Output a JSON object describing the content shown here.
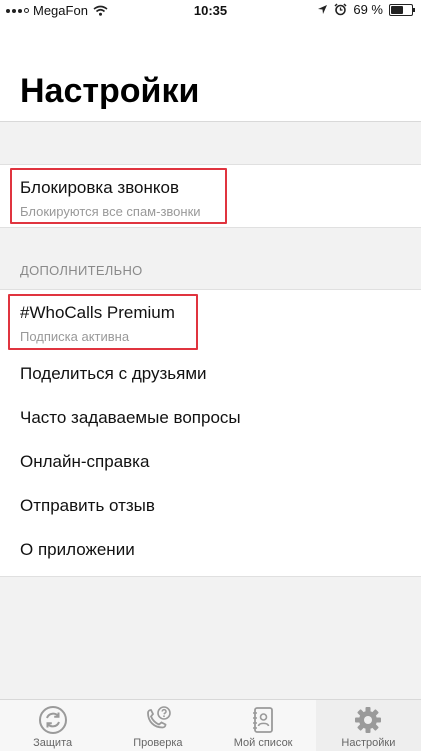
{
  "status_bar": {
    "carrier": "MegaFon",
    "time": "10:35",
    "battery_percent": "69 %",
    "battery_level": 0.69
  },
  "header": {
    "title": "Настройки"
  },
  "blocking": {
    "title": "Блокировка звонков",
    "subtitle": "Блокируются все спам-звонки"
  },
  "additional": {
    "section_title": "ДОПОЛНИТЕЛЬНО",
    "premium": {
      "title": "#WhoCalls Premium",
      "subtitle": "Подписка активна"
    },
    "items": [
      {
        "label": "Поделиться с друзьями"
      },
      {
        "label": "Часто задаваемые вопросы"
      },
      {
        "label": "Онлайн-справка"
      },
      {
        "label": "Отправить отзыв"
      },
      {
        "label": "О приложении"
      }
    ]
  },
  "tab_bar": {
    "tabs": [
      {
        "label": "Защита",
        "icon": "sync-icon"
      },
      {
        "label": "Проверка",
        "icon": "phone-question-icon"
      },
      {
        "label": "Мой список",
        "icon": "contacts-book-icon"
      },
      {
        "label": "Настройки",
        "icon": "gear-icon",
        "active": true
      }
    ]
  },
  "colors": {
    "highlight": "#e0343f",
    "background": "#f2f2f2",
    "tab_icon": "#9a9a9a"
  }
}
